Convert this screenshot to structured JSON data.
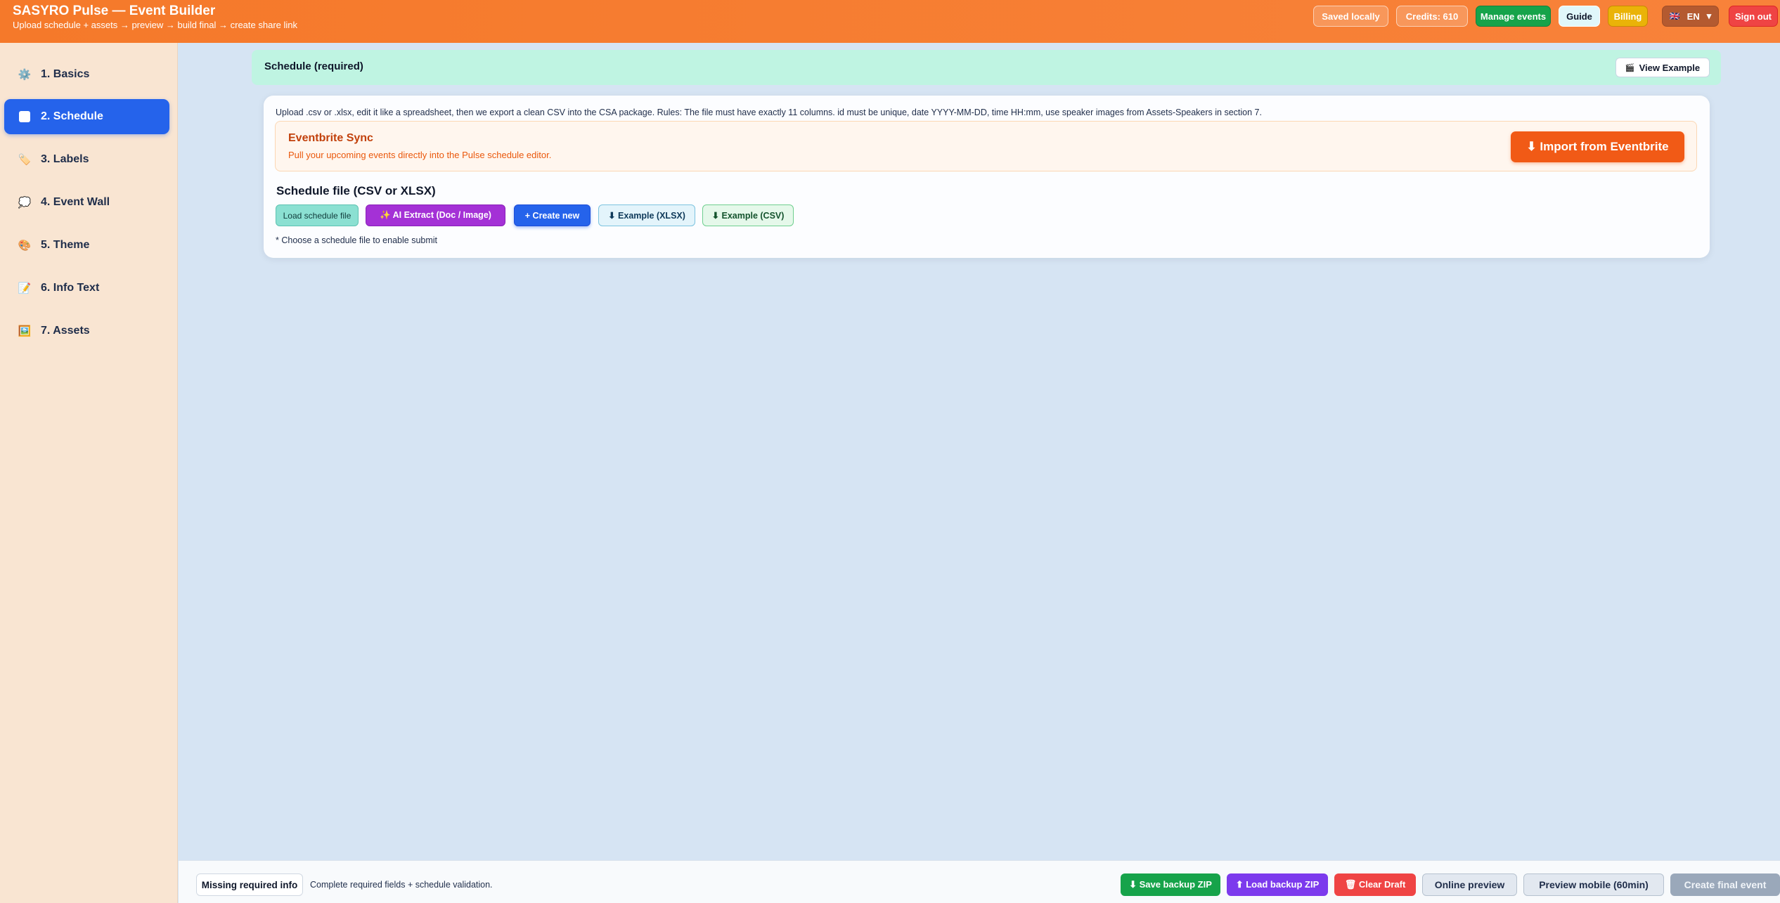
{
  "header": {
    "title": "SASYRO Pulse — Event Builder",
    "subtitle": "Upload schedule + assets → preview → build final → create share link",
    "saved": "Saved locally",
    "credits": "Credits: 610",
    "manage": "Manage events",
    "guide": "Guide",
    "billing": "Billing",
    "lang_flag": "🇬🇧",
    "lang": "EN",
    "lang_caret": "▾",
    "signout": "Sign out"
  },
  "sidebar": {
    "items": [
      {
        "icon": "⚙️",
        "label": "1. Basics"
      },
      {
        "icon": "",
        "label": "2. Schedule"
      },
      {
        "icon": "🏷️",
        "label": "3. Labels"
      },
      {
        "icon": "💭",
        "label": "4. Event Wall"
      },
      {
        "icon": "🎨",
        "label": "5. Theme"
      },
      {
        "icon": "📝",
        "label": "6. Info Text"
      },
      {
        "icon": "🖼️",
        "label": "7. Assets"
      }
    ]
  },
  "banner": {
    "title": "Schedule (required)",
    "view_example_icon": "🎬",
    "view_example": "View Example"
  },
  "card": {
    "rules": "Upload .csv or .xlsx, edit it like a spreadsheet, then we export a clean CSV into the CSA package. Rules: The file must have exactly 11 columns. id must be unique, date YYYY-MM-DD, time HH:mm, use speaker images from Assets-Speakers in section 7.",
    "eventbrite": {
      "title": "Eventbrite Sync",
      "subtitle": "Pull your upcoming events directly into the Pulse schedule editor.",
      "button": "⬇ Import from Eventbrite"
    },
    "schedule_label": "Schedule file (CSV or XLSX)",
    "buttons": {
      "load": "Load schedule file",
      "ai": "✨ AI Extract (Doc / Image)",
      "create": "+ Create new",
      "xlsx": "⬇ Example (XLSX)",
      "csv": "⬇ Example (CSV)"
    },
    "hint": "* Choose a schedule file to enable submit"
  },
  "footer": {
    "missing": "Missing required info",
    "hint": "Complete required fields + schedule validation.",
    "save": "⬇ Save backup ZIP",
    "load": "⬆ Load backup ZIP",
    "clear": "🗑 Clear Draft",
    "online": "Online preview",
    "mobile": "Preview mobile (60min)",
    "final": "Create final event"
  },
  "colors": {
    "header": "#f5792a",
    "accent": "#2563eb",
    "sidebar_bg": "#f9e5d2",
    "page_bg": "#d6e4f3"
  }
}
